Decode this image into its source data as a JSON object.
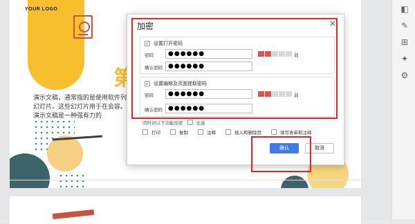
{
  "slide": {
    "logo": "YOUR LOGO",
    "big_char": "第",
    "body_text": "演示文稿，通常指的是使用软件列幻灯片。这些幻灯片用于在会容。演示文稿是一种强有力的"
  },
  "dialog": {
    "title": "加密",
    "close": "×",
    "open_password": {
      "checkbox_label": "设置打开密码",
      "password_label": "密码",
      "password_value": "●●●●●●",
      "confirm_label": "确认密码",
      "confirm_value": "●●●●●●",
      "strength_label": "弱",
      "strength_fraction": 0.2
    },
    "edit_password": {
      "checkbox_label": "设置编辑及页面提取密码",
      "password_label": "密码",
      "password_value": "●●●●●●",
      "confirm_label": "确认密码",
      "confirm_value": "●●●●●●",
      "strength_label": "弱",
      "strength_fraction": 0.2
    },
    "also_allow_label": "同时对以下功能加密",
    "select_all": "全选",
    "options": [
      "打印",
      "复制",
      "注释",
      "插入和删除页",
      "填写表单和注释"
    ],
    "ok_label": "确认",
    "cancel_label": "取消"
  },
  "colors": {
    "accent_blue": "#3b7de2",
    "highlight_red": "#e0252a",
    "strength_red": "#e84c4c",
    "strength_gray": "#d8d8d8"
  }
}
